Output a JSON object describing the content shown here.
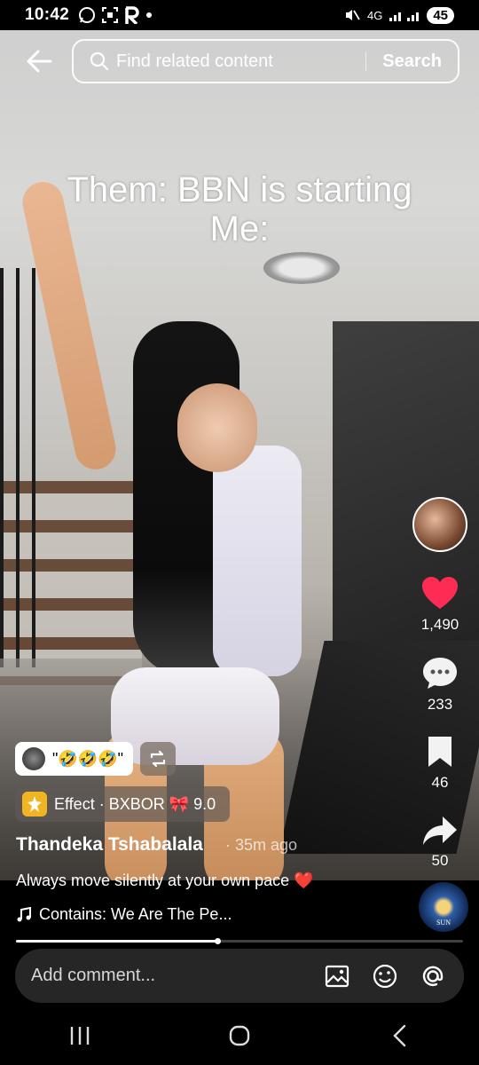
{
  "status_bar": {
    "time": "10:42",
    "left_icons": [
      "whatsapp-icon",
      "screenshot-icon",
      "r-app-icon",
      "dot-icon"
    ],
    "network": "4G",
    "battery": "45"
  },
  "search": {
    "placeholder": "Find related content",
    "button_label": "Search"
  },
  "video": {
    "caption_line1": "Them: BBN is starting",
    "caption_line2": "Me:"
  },
  "actions": {
    "likes": "1,490",
    "comments": "233",
    "saves": "46",
    "shares": "50",
    "like_color": "#fe2c55"
  },
  "post": {
    "reaction_text": "\"🤣🤣🤣\"",
    "effect_label": "Effect · BXBOR 🎀 9.0",
    "username": "Thandeka Tshabalala",
    "time_ago": "· 35m ago",
    "description": "Always move silently at your own pace ❤️",
    "music": "Contains: We Are The Pe...",
    "progress": 0.45
  },
  "comment_bar": {
    "placeholder": "Add comment..."
  },
  "nav": {
    "items": [
      "recent-apps-icon",
      "home-icon",
      "back-icon"
    ]
  }
}
